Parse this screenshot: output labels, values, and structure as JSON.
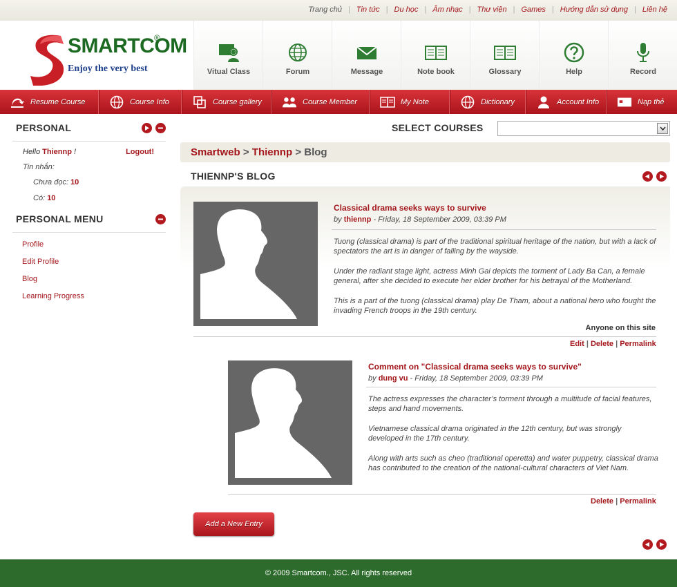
{
  "toplinks": [
    {
      "label": "Trang chủ"
    },
    {
      "label": "Tin tức"
    },
    {
      "label": "Du học"
    },
    {
      "label": "Âm nhạc"
    },
    {
      "label": "Thư viện"
    },
    {
      "label": "Games"
    },
    {
      "label": "Hướng dẫn sử dụng"
    },
    {
      "label": "Liên hệ"
    }
  ],
  "logo": {
    "name": "SMARTCOM",
    "reg": "®",
    "tagline": "Enjoy the very best"
  },
  "modules": [
    {
      "label": "Vitual Class",
      "icon": "virtual-class-icon"
    },
    {
      "label": "Forum",
      "icon": "globe-icon"
    },
    {
      "label": "Message",
      "icon": "envelope-icon"
    },
    {
      "label": "Note book",
      "icon": "notebook-icon"
    },
    {
      "label": "Glossary",
      "icon": "book-icon"
    },
    {
      "label": "Help",
      "icon": "help-icon"
    },
    {
      "label": "Record",
      "icon": "microphone-icon"
    }
  ],
  "nav": [
    {
      "label": "Resume Course",
      "icon": "resume-icon"
    },
    {
      "label": "Course Info",
      "icon": "globe-icon"
    },
    {
      "label": "Course gallery",
      "icon": "gallery-icon"
    },
    {
      "label": "Course Member",
      "icon": "members-icon"
    },
    {
      "label": "My Note",
      "icon": "note-icon"
    },
    {
      "label": "Dictionary",
      "icon": "globe-icon"
    },
    {
      "label": "Account Info",
      "icon": "user-icon"
    },
    {
      "label": "Nạp thẻ",
      "icon": "card-icon"
    }
  ],
  "personal": {
    "title": "PERSONAL",
    "hello_prefix": "Hello",
    "username": "Thiennp",
    "hello_suffix": "!",
    "logout": "Logout!",
    "messages_label": "Tin nhắn:",
    "unread_label": "Chưa đọc:",
    "unread_count": "10",
    "total_label": "Có:",
    "total_count": "10"
  },
  "personal_menu": {
    "title": "PERSONAL MENU",
    "items": [
      {
        "label": "Profile"
      },
      {
        "label": "Edit Profile"
      },
      {
        "label": "Blog"
      },
      {
        "label": "Learning Progress"
      }
    ]
  },
  "select_courses": {
    "label": "SELECT COURSES",
    "value": ""
  },
  "breadcrumb": {
    "root": "Smartweb",
    "sep": ">",
    "user": "Thiennp",
    "current": "Blog"
  },
  "blog": {
    "title": "THIENNP'S BLOG"
  },
  "post": {
    "title": "Classical drama seeks ways to survive",
    "by": "by",
    "author": "thiennp",
    "date": "- Friday, 18 September 2009, 03:39 PM",
    "paragraphs": [
      "Tuong (classical drama) is part of the traditional spiritual heritage of the nation, but with a lack of spectators the art is in danger of falling by the wayside.",
      "Under the radiant stage light, actress Minh Gai depicts the torment of Lady Ba Can, a female general, after she decided to execute her elder brother for his betrayal of the Motherland.",
      "This is a part of the tuong (classical drama) play De Tham, about a national hero who fought the invading French troops in the 19th century."
    ],
    "visibility": "Anyone on this site",
    "actions": {
      "edit": "Edit",
      "delete": "Delete",
      "permalink": "Permalink",
      "sep": "|"
    }
  },
  "comment": {
    "title": "Comment on \"Classical drama seeks ways to survive\"",
    "by": "by",
    "author": "dung vu",
    "date": "- Friday, 18 September 2009, 03:39 PM",
    "paragraphs": [
      "The actress expresses the character’s torment through a multitude of facial features, steps and hand movements.",
      "Vietnamese classical drama originated in the 12th century, but was strongly developed in the 17th century.",
      "Along with arts such as cheo (traditional operetta) and water puppetry, classical drama has contributed to the creation of the national-cultural characters of Viet Nam."
    ],
    "actions": {
      "delete": "Delete",
      "permalink": "Permalink",
      "sep": "|"
    }
  },
  "add_entry": "Add a New Entry",
  "footer": "© 2009 Smartcom., JSC. All rights reserved",
  "colors": {
    "brand_red": "#a3171c",
    "brand_green": "#2c6b2b",
    "nav_red": "#c5232a"
  }
}
